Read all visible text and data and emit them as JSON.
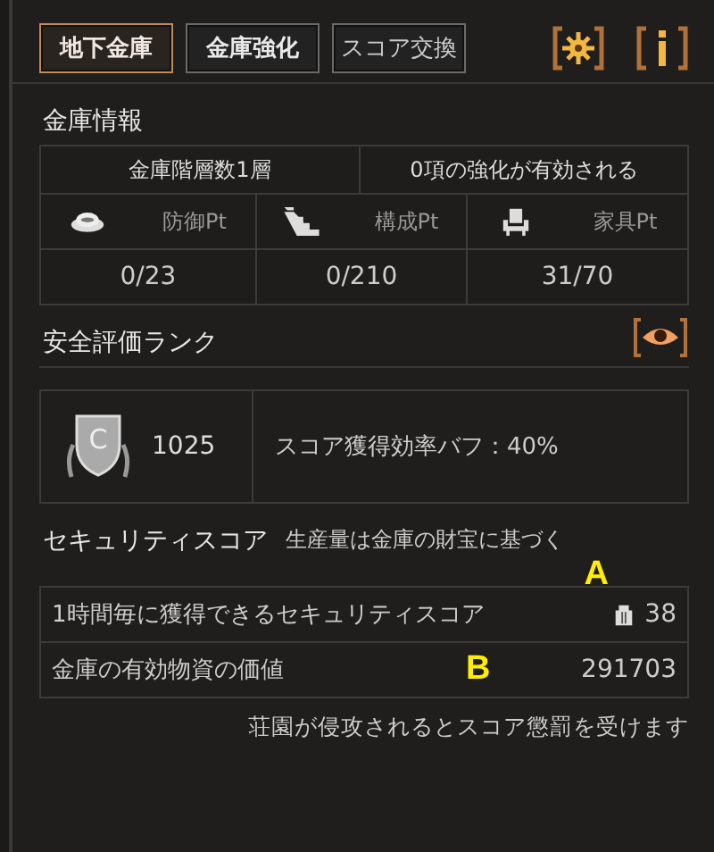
{
  "tabs": [
    {
      "label": "地下金庫",
      "selected": true
    },
    {
      "label": "金庫強化",
      "selected": false
    },
    {
      "label": "スコア交換",
      "selected": false
    }
  ],
  "vault_info": {
    "title": "金庫情報",
    "summary": [
      "金庫階層数1層",
      "0項の強化が有効される"
    ],
    "points": [
      {
        "label": "防御Pt",
        "value": "0/23"
      },
      {
        "label": "構成Pt",
        "value": "0/210"
      },
      {
        "label": "家具Pt",
        "value": "31/70"
      }
    ]
  },
  "safety_rank": {
    "title": "安全評価ランク",
    "rank": "C",
    "score": "1025",
    "buff": "スコア獲得効率バフ：40%"
  },
  "security_score": {
    "title": "セキュリティスコア",
    "subtitle": "生産量は金庫の財宝に基づく",
    "rows": [
      {
        "label": "1時間毎に獲得できるセキュリティスコア",
        "value": "38",
        "marker": "A"
      },
      {
        "label": "金庫の有効物資の価値",
        "value": "291703",
        "marker": "B"
      }
    ],
    "note": "荘園が侵攻されるとスコア懲罰を受けます"
  }
}
